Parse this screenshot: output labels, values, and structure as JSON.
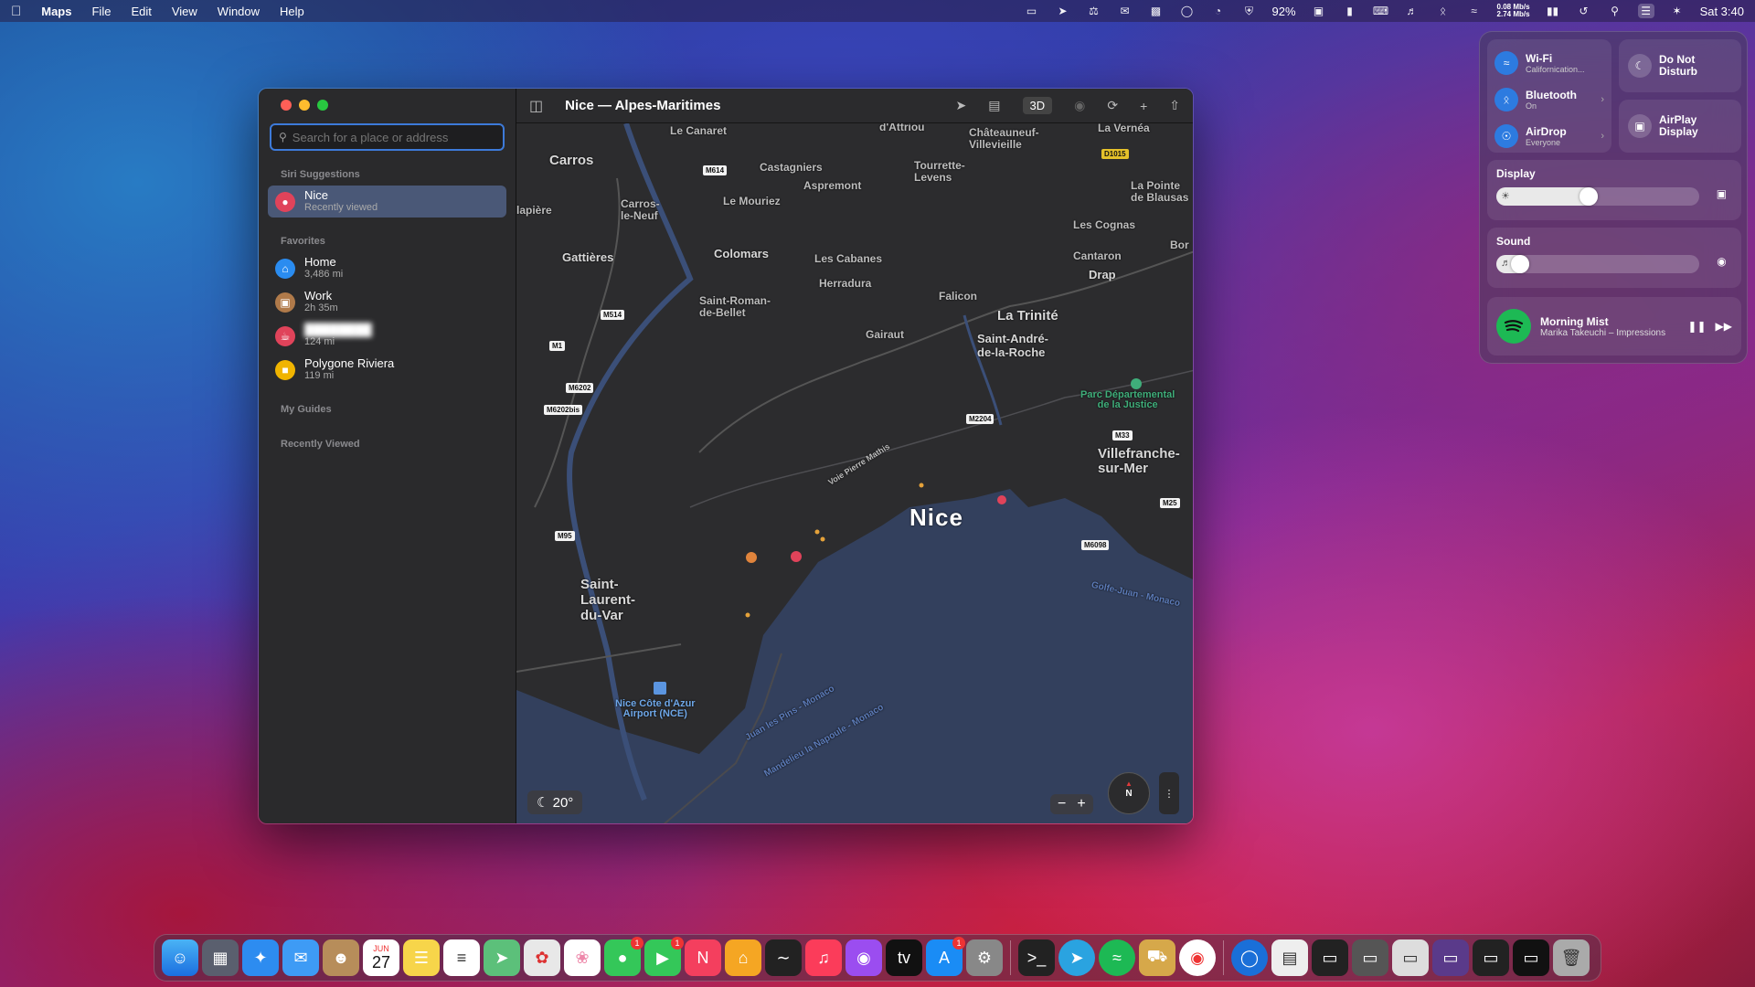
{
  "menubar": {
    "app": "Maps",
    "menus": [
      "File",
      "Edit",
      "View",
      "Window",
      "Help"
    ],
    "battery": "92%",
    "net_up": "0.08 Mb/s",
    "net_down": "2.74 Mb/s",
    "clock": "Sat 3:40"
  },
  "window": {
    "title": "Nice — Alpes-Maritimes",
    "toolbar_3d": "3D",
    "search_placeholder": "Search for a place or address",
    "siri_header": "Siri Suggestions",
    "siri_item": {
      "title": "Nice",
      "subtitle": "Recently viewed"
    },
    "favorites_header": "Favorites",
    "favorites": [
      {
        "title": "Home",
        "subtitle": "3,486 mi",
        "color": "#2a8cf0",
        "icon": "home-icon"
      },
      {
        "title": "Work",
        "subtitle": "2h 35m",
        "color": "#b07a4a",
        "icon": "briefcase-icon"
      },
      {
        "title": "",
        "subtitle": "124 mi",
        "color": "#e0435a",
        "icon": "fork-knife-icon"
      },
      {
        "title": "Polygone Riviera",
        "subtitle": "119 mi",
        "color": "#f0b400",
        "icon": "shopping-bag-icon"
      }
    ],
    "guides_header": "My Guides",
    "recent_header": "Recently Viewed"
  },
  "map": {
    "labels": {
      "le_canaret": "Le Canaret",
      "carros": "Carros",
      "castagniers": "Castagniers",
      "aspremont": "Aspremont",
      "le_mouriez": "Le Mouriez",
      "dattriou": "d'Attriou",
      "chateauneuf": "Châteauneuf-\nVillevieille",
      "la_vernea": "La Vernéa",
      "tourrette": "Tourrette-\nLevens",
      "la_pointe": "La Pointe\nde Blausas",
      "lapiere": "lapière",
      "carros_le_neuf": "Carros-\nle-Neuf",
      "les_cognas": "Les Cognas",
      "gattieres": "Gattières",
      "colomars": "Colomars",
      "les_cabanes": "Les Cabanes",
      "cantaron": "Cantaron",
      "drap": "Drap",
      "herradura": "Herradura",
      "falicon": "Falicon",
      "saint_roman": "Saint-Roman-\nde-Bellet",
      "la_trinite": "La Trinité",
      "gairaut": "Gairaut",
      "saint_andre": "Saint-André-\nde-la-Roche",
      "parc": "Parc Départemental\nde la Justice",
      "villefranche": "Villefranche-\nsur-Mer",
      "voie": "Voie Pierre Mathis",
      "nice": "Nice",
      "saint_laurent": "Saint-\nLaurent-\ndu-Var",
      "airport": "Nice Côte d'Azur\nAirport (NCE)",
      "golfe": "Golfe-Juan - Monaco",
      "juan": "Juan les Pins - Monaco",
      "mandelieu": "Mandelieu la Napoule - Monaco",
      "bo": "Bor"
    },
    "shields": {
      "m614": "M614",
      "d1015": "D1015",
      "m514": "M514",
      "m1": "M1",
      "m6202": "M6202",
      "m6202bis": "M6202bis",
      "m2204": "M2204",
      "m33": "M33",
      "m95": "M95",
      "m25": "M25",
      "m6098": "M6098"
    },
    "weather": "20°",
    "compass": "N"
  },
  "control_center": {
    "wifi": {
      "title": "Wi-Fi",
      "subtitle": "Californication..."
    },
    "bluetooth": {
      "title": "Bluetooth",
      "subtitle": "On"
    },
    "airdrop": {
      "title": "AirDrop",
      "subtitle": "Everyone"
    },
    "dnd": "Do Not\nDisturb",
    "airplay": "AirPlay\nDisplay",
    "display_label": "Display",
    "display_level": 0.5,
    "sound_label": "Sound",
    "sound_level": 0.16,
    "music_title": "Morning Mist",
    "music_artist": "Marika Takeuchi – Impressions"
  },
  "dock": {
    "calendar_month": "JUN",
    "calendar_day": "27",
    "badges": {
      "messages": "1",
      "facetime": "1",
      "appstore": "1"
    }
  }
}
